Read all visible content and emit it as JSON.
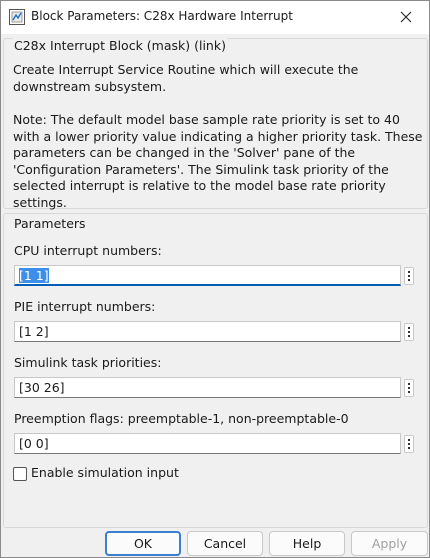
{
  "window": {
    "title": "Block Parameters: C28x Hardware Interrupt"
  },
  "mask_group": {
    "legend": "C28x Interrupt Block (mask) (link)",
    "description_line1": "Create Interrupt Service Routine which will execute the downstream subsystem.",
    "description_note": "Note: The default model base sample rate priority is set to 40 with a lower priority value indicating a higher priority task. These parameters can be changed in the 'Solver' pane of the 'Configuration Parameters'. The Simulink task priority of the selected interrupt is relative to the model base rate priority settings."
  },
  "parameters": {
    "legend": "Parameters",
    "cpu_interrupt_numbers": {
      "label": "CPU interrupt numbers:",
      "value": "[1 1]"
    },
    "pie_interrupt_numbers": {
      "label": "PIE interrupt numbers:",
      "value": "[1 2]"
    },
    "simulink_task_priorities": {
      "label": "Simulink task priorities:",
      "value": "[30 26]"
    },
    "preemption_flags": {
      "label": "Preemption flags: preemptable-1, non-preemptable-0",
      "value": "[0 0]"
    },
    "enable_simulation_input": {
      "label": "Enable simulation input",
      "checked": false
    }
  },
  "buttons": {
    "ok": "OK",
    "cancel": "Cancel",
    "help": "Help",
    "apply": "Apply"
  },
  "colors": {
    "accent": "#005fb8",
    "selection": "#3d8ee8",
    "dialog_bg": "#f0f0f0"
  },
  "icons": {
    "window": "simulink-block-icon",
    "close": "close-icon",
    "field_menu": "vertical-ellipsis-icon"
  }
}
